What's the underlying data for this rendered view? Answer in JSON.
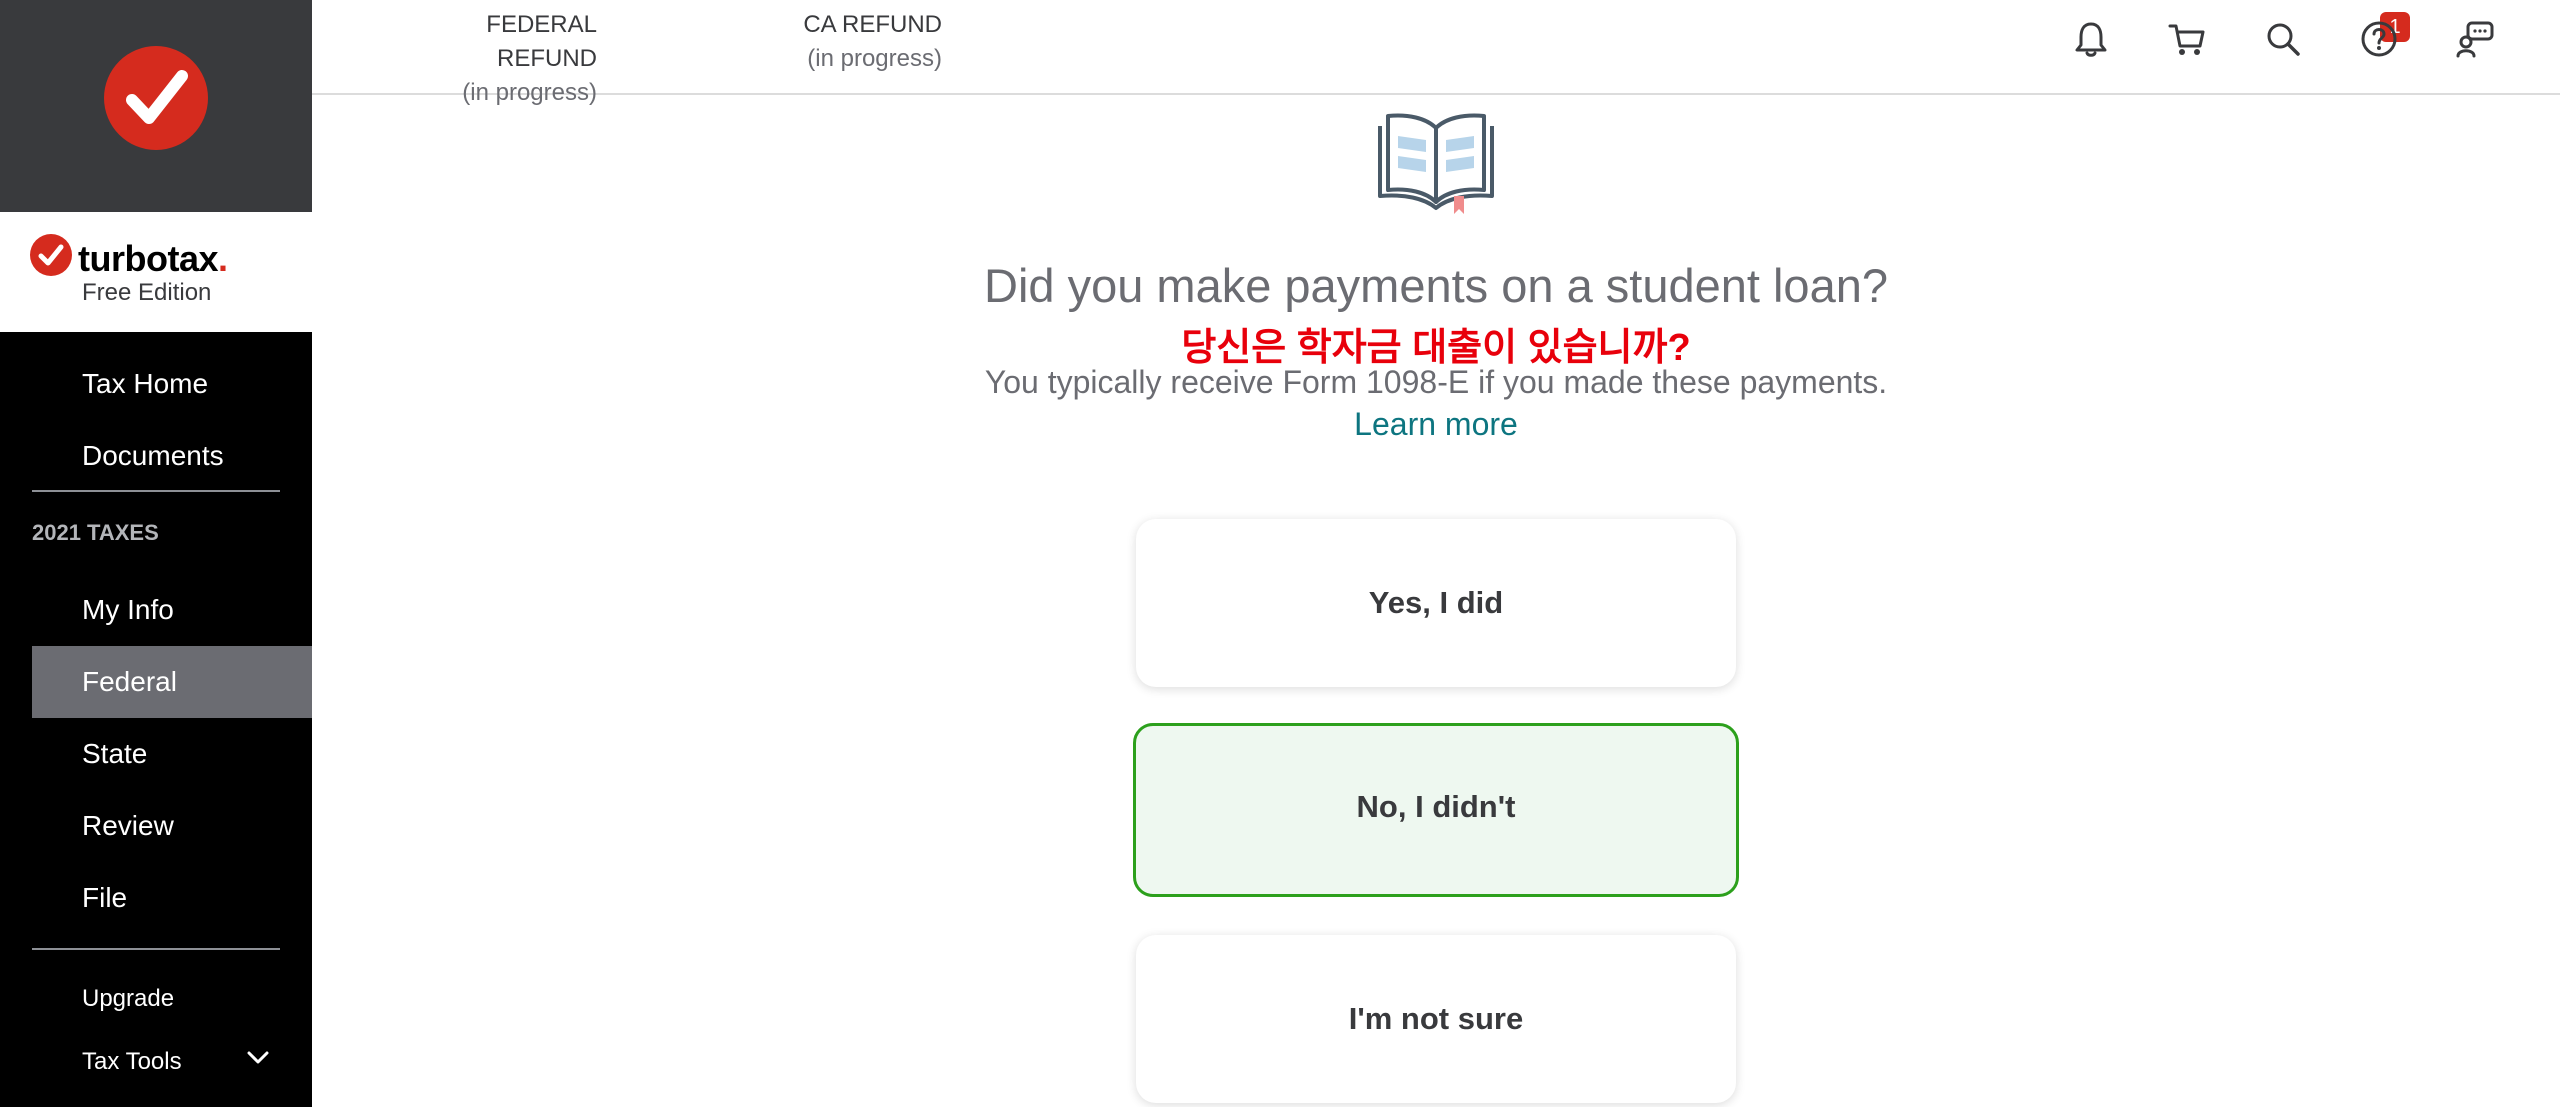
{
  "app": {
    "name": "turbotax",
    "name_dot": ".",
    "edition": "Free Edition",
    "brand_color": "#d52b1e"
  },
  "header": {
    "federal_refund": {
      "label": "FEDERAL REFUND",
      "status": "(in progress)"
    },
    "ca_refund": {
      "label": "CA REFUND",
      "status": "(in progress)"
    },
    "notification_count": "1",
    "icons": [
      "bell-icon",
      "cart-icon",
      "search-icon",
      "help-icon",
      "chat-icon"
    ]
  },
  "sidebar": {
    "primary": [
      "Tax Home",
      "Documents"
    ],
    "section_title": "2021 TAXES",
    "tax_steps": [
      "My Info",
      "Federal",
      "State",
      "Review",
      "File"
    ],
    "active_step": "Federal",
    "footer": [
      "Upgrade",
      "Tax Tools"
    ]
  },
  "main": {
    "question": "Did you make payments on a student loan?",
    "question_korean": "당신은 학자금 대출이 있습니까?",
    "subtext": "You typically receive Form 1098-E if you made these payments.",
    "learn_more": "Learn more",
    "choices": [
      "Yes, I did",
      "No, I didn't",
      "I'm not sure"
    ],
    "selected_choice": "No, I didn't",
    "accent_color": "#2ca01c"
  }
}
